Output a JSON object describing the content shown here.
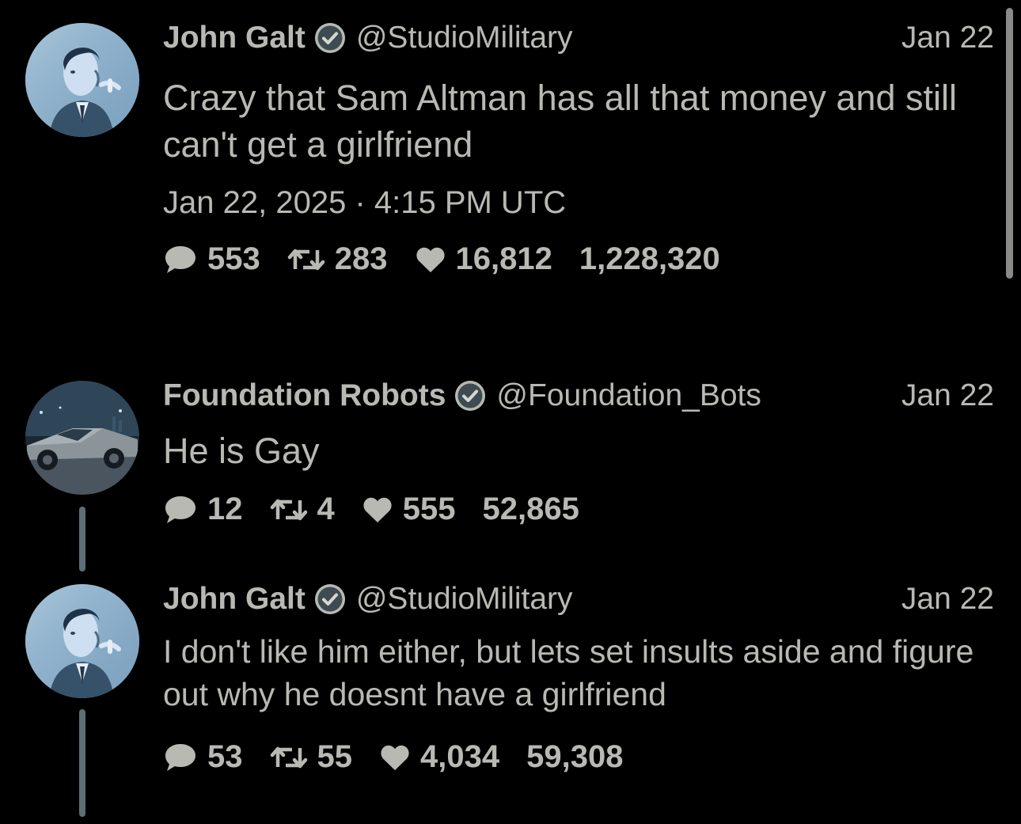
{
  "tweets": [
    {
      "name": "John Galt",
      "handle": "@StudioMilitary",
      "date": "Jan 22",
      "text": "Crazy that Sam Altman has all that money and still can't get a girlfriend",
      "timestamp": "Jan 22, 2025 · 4:15 PM UTC",
      "replies": "553",
      "retweets": "283",
      "likes": "16,812",
      "views": "1,228,320",
      "avatar": "portrait-man-photo"
    },
    {
      "name": "Foundation Robots",
      "handle": "@Foundation_Bots",
      "date": "Jan 22",
      "text": "He is Gay",
      "replies": "12",
      "retweets": "4",
      "likes": "555",
      "views": "52,865",
      "avatar": "cybertruck-photo"
    },
    {
      "name": "John Galt",
      "handle": "@StudioMilitary",
      "date": "Jan 22",
      "text": "I don't like him either, but lets set insults aside and figure out why he doesnt have a girlfriend",
      "replies": "53",
      "retweets": "55",
      "likes": "4,034",
      "views": "59,308",
      "avatar": "portrait-man-photo"
    }
  ],
  "icons": {
    "reply": "comment-bubble-icon",
    "retweet": "retweet-icon",
    "like": "heart-icon",
    "verified": "verified-check-icon"
  },
  "colors": {
    "background": "#000000",
    "text": "#b9b9b4",
    "thread_line": "#5e6e76",
    "verified_badge": "#b9b9b4"
  }
}
